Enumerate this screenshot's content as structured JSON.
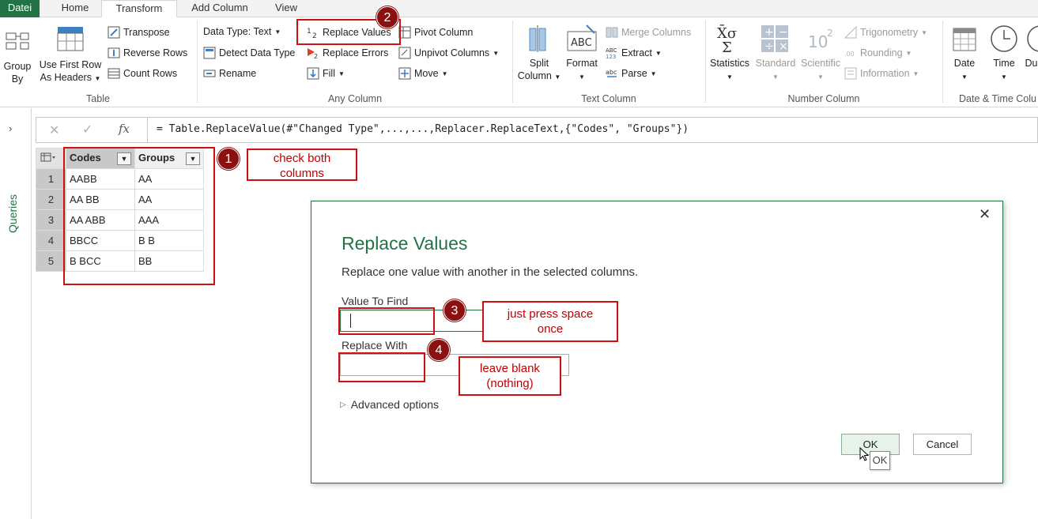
{
  "tabs": [
    "Datei",
    "Home",
    "Transform",
    "Add Column",
    "View"
  ],
  "ribbon": {
    "table_group": {
      "label": "Table",
      "group_by": [
        "Group",
        "By"
      ],
      "use_first_row": [
        "Use First Row",
        "As Headers"
      ],
      "transpose": "Transpose",
      "reverse_rows": "Reverse Rows",
      "count_rows": "Count Rows"
    },
    "any_column_group": {
      "label": "Any Column",
      "data_type": "Data Type: Text",
      "detect_data_type": "Detect Data Type",
      "rename": "Rename",
      "replace_values": "Replace Values",
      "replace_errors": "Replace Errors",
      "fill": "Fill",
      "pivot_column": "Pivot Column",
      "unpivot_columns": "Unpivot Columns",
      "move": "Move"
    },
    "text_column_group": {
      "label": "Text Column",
      "split_column": [
        "Split",
        "Column"
      ],
      "format": "Format",
      "merge_columns": "Merge Columns",
      "extract": "Extract",
      "parse": "Parse"
    },
    "number_column_group": {
      "label": "Number Column",
      "statistics": "Statistics",
      "standard": "Standard",
      "scientific": "Scientific",
      "trigonometry": "Trigonometry",
      "rounding": "Rounding",
      "information": "Information"
    },
    "datetime_group": {
      "label": "Date & Time Colu",
      "date": "Date",
      "time": "Time",
      "duration": "Du"
    }
  },
  "sidebar": {
    "queries_label": "Queries"
  },
  "formula_bar": {
    "formula": "= Table.ReplaceValue(#\"Changed Type\",...,...,Replacer.ReplaceText,{\"Codes\", \"Groups\"})"
  },
  "table": {
    "columns": [
      "Codes",
      "Groups"
    ],
    "rows": [
      {
        "n": "1",
        "codes": "AABB",
        "groups": "AA"
      },
      {
        "n": "2",
        "codes": "AA BB",
        "groups": "AA"
      },
      {
        "n": "3",
        "codes": "AA ABB",
        "groups": "AAA"
      },
      {
        "n": "4",
        "codes": "BBCC",
        "groups": "B B"
      },
      {
        "n": "5",
        "codes": "B BCC",
        "groups": "BB"
      }
    ]
  },
  "annotations": {
    "badge1": "1",
    "badge2": "2",
    "badge3": "3",
    "badge4": "4",
    "note1": [
      "check both",
      "columns"
    ],
    "note3": [
      "just press space",
      "once"
    ],
    "note4": [
      "leave blank",
      "(nothing)"
    ]
  },
  "dialog": {
    "title": "Replace Values",
    "description": "Replace one value with another in the selected columns.",
    "value_to_find_label": "Value To Find",
    "value_to_find": "",
    "replace_with_label": "Replace With",
    "replace_with": "",
    "advanced_options": "Advanced options",
    "ok": "OK",
    "cancel": "Cancel",
    "tooltip": "OK"
  },
  "colors": {
    "accent": "#217346",
    "annotation_red": "#d01010",
    "badge": "#8b1010"
  }
}
